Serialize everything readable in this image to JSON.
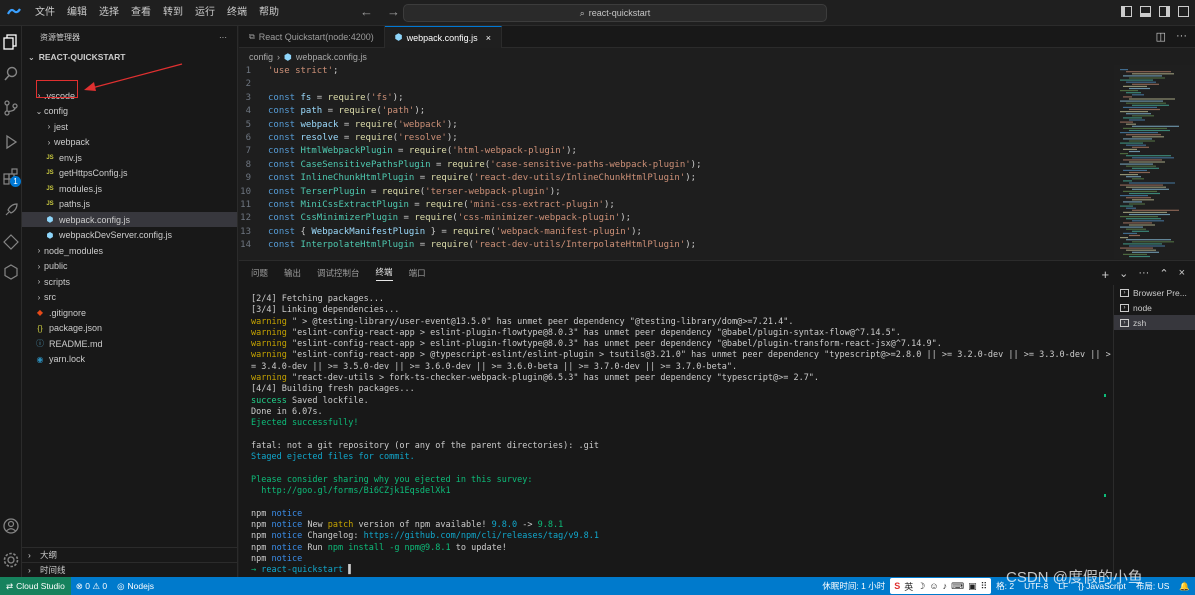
{
  "titlebar": {
    "menu": [
      "文件",
      "编辑",
      "选择",
      "查看",
      "转到",
      "运行",
      "终端",
      "帮助"
    ],
    "command_center": "react-quickstart"
  },
  "sidebar": {
    "header": "资源管理器",
    "more": "···",
    "project": "REACT-QUICKSTART",
    "items": [
      {
        "label": ".vscode",
        "type": "folder",
        "depth": 1,
        "chev": "›"
      },
      {
        "label": "config",
        "type": "folder",
        "depth": 1,
        "chev": "⌄"
      },
      {
        "label": "jest",
        "type": "folder",
        "depth": 2,
        "chev": "›"
      },
      {
        "label": "webpack",
        "type": "folder",
        "depth": 2,
        "chev": "›"
      },
      {
        "label": "env.js",
        "type": "js",
        "depth": 2
      },
      {
        "label": "getHttpsConfig.js",
        "type": "js",
        "depth": 2
      },
      {
        "label": "modules.js",
        "type": "js",
        "depth": 2
      },
      {
        "label": "paths.js",
        "type": "js",
        "depth": 2
      },
      {
        "label": "webpack.config.js",
        "type": "webpack",
        "depth": 2,
        "selected": true
      },
      {
        "label": "webpackDevServer.config.js",
        "type": "webpack",
        "depth": 2
      },
      {
        "label": "node_modules",
        "type": "folder",
        "depth": 1,
        "chev": "›"
      },
      {
        "label": "public",
        "type": "folder",
        "depth": 1,
        "chev": "›"
      },
      {
        "label": "scripts",
        "type": "folder",
        "depth": 1,
        "chev": "›"
      },
      {
        "label": "src",
        "type": "folder",
        "depth": 1,
        "chev": "›"
      },
      {
        "label": ".gitignore",
        "type": "git",
        "depth": 1
      },
      {
        "label": "package.json",
        "type": "json",
        "depth": 1
      },
      {
        "label": "README.md",
        "type": "md",
        "depth": 1
      },
      {
        "label": "yarn.lock",
        "type": "yarn",
        "depth": 1
      }
    ],
    "outline": "大纲",
    "timeline": "时间线"
  },
  "tabs": [
    {
      "label": "React Quickstart(node:4200)",
      "active": false
    },
    {
      "label": "webpack.config.js",
      "active": true,
      "close": "×"
    }
  ],
  "breadcrumb": {
    "folder": "config",
    "sep": "›",
    "file": "webpack.config.js"
  },
  "code": [
    {
      "n": "1",
      "t": [
        [
          "st",
          "'use strict'"
        ],
        [
          "ct",
          ";"
        ]
      ]
    },
    {
      "n": "2",
      "t": []
    },
    {
      "n": "3",
      "t": [
        [
          "kw",
          "const "
        ],
        [
          "vr",
          "fs"
        ],
        [
          "ct",
          " = "
        ],
        [
          "fn",
          "require"
        ],
        [
          "ct",
          "("
        ],
        [
          "st",
          "'fs'"
        ],
        [
          "ct",
          ");"
        ]
      ]
    },
    {
      "n": "4",
      "t": [
        [
          "kw",
          "const "
        ],
        [
          "vr",
          "path"
        ],
        [
          "ct",
          " = "
        ],
        [
          "fn",
          "require"
        ],
        [
          "ct",
          "("
        ],
        [
          "st",
          "'path'"
        ],
        [
          "ct",
          ");"
        ]
      ]
    },
    {
      "n": "5",
      "t": [
        [
          "kw",
          "const "
        ],
        [
          "vr",
          "webpack"
        ],
        [
          "ct",
          " = "
        ],
        [
          "fn",
          "require"
        ],
        [
          "ct",
          "("
        ],
        [
          "st",
          "'webpack'"
        ],
        [
          "ct",
          ");"
        ]
      ]
    },
    {
      "n": "6",
      "t": [
        [
          "kw",
          "const "
        ],
        [
          "vr",
          "resolve"
        ],
        [
          "ct",
          " = "
        ],
        [
          "fn",
          "require"
        ],
        [
          "ct",
          "("
        ],
        [
          "st",
          "'resolve'"
        ],
        [
          "ct",
          ");"
        ]
      ]
    },
    {
      "n": "7",
      "t": [
        [
          "kw",
          "const "
        ],
        [
          "cls",
          "HtmlWebpackPlugin"
        ],
        [
          "ct",
          " = "
        ],
        [
          "fn",
          "require"
        ],
        [
          "ct",
          "("
        ],
        [
          "st",
          "'html-webpack-plugin'"
        ],
        [
          "ct",
          ");"
        ]
      ]
    },
    {
      "n": "8",
      "t": [
        [
          "kw",
          "const "
        ],
        [
          "cls",
          "CaseSensitivePathsPlugin"
        ],
        [
          "ct",
          " = "
        ],
        [
          "fn",
          "require"
        ],
        [
          "ct",
          "("
        ],
        [
          "st",
          "'case-sensitive-paths-webpack-plugin'"
        ],
        [
          "ct",
          ");"
        ]
      ]
    },
    {
      "n": "9",
      "t": [
        [
          "kw",
          "const "
        ],
        [
          "cls",
          "InlineChunkHtmlPlugin"
        ],
        [
          "ct",
          " = "
        ],
        [
          "fn",
          "require"
        ],
        [
          "ct",
          "("
        ],
        [
          "st",
          "'react-dev-utils/InlineChunkHtmlPlugin'"
        ],
        [
          "ct",
          ");"
        ]
      ]
    },
    {
      "n": "10",
      "t": [
        [
          "kw",
          "const "
        ],
        [
          "cls",
          "TerserPlugin"
        ],
        [
          "ct",
          " = "
        ],
        [
          "fn",
          "require"
        ],
        [
          "ct",
          "("
        ],
        [
          "st",
          "'terser-webpack-plugin'"
        ],
        [
          "ct",
          ");"
        ]
      ]
    },
    {
      "n": "11",
      "t": [
        [
          "kw",
          "const "
        ],
        [
          "cls",
          "MiniCssExtractPlugin"
        ],
        [
          "ct",
          " = "
        ],
        [
          "fn",
          "require"
        ],
        [
          "ct",
          "("
        ],
        [
          "st",
          "'mini-css-extract-plugin'"
        ],
        [
          "ct",
          ");"
        ]
      ]
    },
    {
      "n": "12",
      "t": [
        [
          "kw",
          "const "
        ],
        [
          "cls",
          "CssMinimizerPlugin"
        ],
        [
          "ct",
          " = "
        ],
        [
          "fn",
          "require"
        ],
        [
          "ct",
          "("
        ],
        [
          "st",
          "'css-minimizer-webpack-plugin'"
        ],
        [
          "ct",
          ");"
        ]
      ]
    },
    {
      "n": "13",
      "t": [
        [
          "kw",
          "const "
        ],
        [
          "ct",
          "{ "
        ],
        [
          "vr",
          "WebpackManifestPlugin"
        ],
        [
          "ct",
          " } = "
        ],
        [
          "fn",
          "require"
        ],
        [
          "ct",
          "("
        ],
        [
          "st",
          "'webpack-manifest-plugin'"
        ],
        [
          "ct",
          ");"
        ]
      ]
    },
    {
      "n": "14",
      "t": [
        [
          "kw",
          "const "
        ],
        [
          "cls",
          "InterpolateHtmlPlugin"
        ],
        [
          "ct",
          " = "
        ],
        [
          "fn",
          "require"
        ],
        [
          "ct",
          "("
        ],
        [
          "st",
          "'react-dev-utils/InterpolateHtmlPlugin'"
        ],
        [
          "ct",
          ");"
        ]
      ]
    }
  ],
  "panel": {
    "tabs": [
      "问题",
      "输出",
      "调试控制台",
      "终端",
      "端口"
    ],
    "active_tab": "终端",
    "actions": [
      "+",
      "⌄",
      "···",
      "⌃",
      "×"
    ],
    "terminals": [
      {
        "label": "Browser Pre...",
        "selected": false
      },
      {
        "label": "node",
        "selected": false
      },
      {
        "label": "zsh",
        "selected": true
      }
    ],
    "lines": [
      [
        [
          "ct",
          "[2/4] Fetching packages..."
        ]
      ],
      [
        [
          "ct",
          "[3/4] Linking dependencies..."
        ]
      ],
      [
        [
          "tw",
          "warning"
        ],
        [
          "ct",
          " \" > @testing-library/user-event@13.5.0\" has unmet peer dependency \"@testing-library/dom@>=7.21.4\"."
        ]
      ],
      [
        [
          "tw",
          "warning"
        ],
        [
          "ct",
          " \"eslint-config-react-app > eslint-plugin-flowtype@8.0.3\" has unmet peer dependency \"@babel/plugin-syntax-flow@^7.14.5\"."
        ]
      ],
      [
        [
          "tw",
          "warning"
        ],
        [
          "ct",
          " \"eslint-config-react-app > eslint-plugin-flowtype@8.0.3\" has unmet peer dependency \"@babel/plugin-transform-react-jsx@^7.14.9\"."
        ]
      ],
      [
        [
          "tw",
          "warning"
        ],
        [
          "ct",
          " \"eslint-config-react-app > @typescript-eslint/eslint-plugin > tsutils@3.21.0\" has unmet peer dependency \"typescript@>=2.8.0 || >= 3.2.0-dev || >= 3.3.0-dev || >"
        ]
      ],
      [
        [
          "ct",
          "= 3.4.0-dev || >= 3.5.0-dev || >= 3.6.0-dev || >= 3.6.0-beta || >= 3.7.0-dev || >= 3.7.0-beta\"."
        ]
      ],
      [
        [
          "tw",
          "warning"
        ],
        [
          "ct",
          " \"react-dev-utils > fork-ts-checker-webpack-plugin@6.5.3\" has unmet peer dependency \"typescript@>= 2.7\"."
        ]
      ],
      [
        [
          "ct",
          "[4/4] Building fresh packages..."
        ]
      ],
      [
        [
          "tg",
          "success"
        ],
        [
          "ct",
          " Saved lockfile."
        ]
      ],
      [
        [
          "ct",
          "Done in 6.07s."
        ]
      ],
      [
        [
          "tgr",
          "Ejected successfully!"
        ]
      ],
      [],
      [
        [
          "ct",
          "fatal: not a git repository (or any of the parent directories): .git"
        ]
      ],
      [
        [
          "tc",
          "Staged ejected files for commit."
        ]
      ],
      [],
      [
        [
          "tgr",
          "Please consider sharing why you ejected in this survey:"
        ]
      ],
      [
        [
          "tgr",
          "  http://goo.gl/forms/Bi6CZjk1EqsdelXk1"
        ]
      ],
      [],
      [
        [
          "ct",
          "npm "
        ],
        [
          "tb",
          "notice"
        ]
      ],
      [
        [
          "ct",
          "npm "
        ],
        [
          "tb",
          "notice"
        ],
        [
          "ct",
          " New "
        ],
        [
          "tw",
          "patch"
        ],
        [
          "ct",
          " version of npm available! "
        ],
        [
          "tc",
          "9.8.0"
        ],
        [
          "ct",
          " -> "
        ],
        [
          "tgr",
          "9.8.1"
        ]
      ],
      [
        [
          "ct",
          "npm "
        ],
        [
          "tb",
          "notice"
        ],
        [
          "ct",
          " Changelog: "
        ],
        [
          "tc",
          "https://github.com/npm/cli/releases/tag/v9.8.1"
        ]
      ],
      [
        [
          "ct",
          "npm "
        ],
        [
          "tb",
          "notice"
        ],
        [
          "ct",
          " Run "
        ],
        [
          "tgr",
          "npm install -g npm@9.8.1"
        ],
        [
          "ct",
          " to update!"
        ]
      ],
      [
        [
          "ct",
          "npm "
        ],
        [
          "tb",
          "notice"
        ]
      ],
      [
        [
          "tgr",
          "→ "
        ],
        [
          "tc",
          "react-quickstart"
        ],
        [
          "ct",
          " ▌"
        ]
      ]
    ]
  },
  "status": {
    "remote": "Cloud Studio",
    "errors": "⊗ 0 ⚠ 0",
    "nodejs": "Nodejs",
    "right_text": "休眠时间: 1 小时",
    "ime": [
      "英",
      "♪",
      "☺",
      "🎤",
      "⌨",
      "👕",
      "⚙"
    ],
    "indent": "格: 2",
    "encoding": "UTF-8",
    "eol": "LF",
    "lang": "{} JavaScript",
    "layout": "布局: US"
  },
  "watermark": "CSDN @度假的小鱼",
  "colors": {
    "accent": "#007acc",
    "remote": "#16825d",
    "highlight_box": "#e03030",
    "arrow": "#e03030"
  }
}
